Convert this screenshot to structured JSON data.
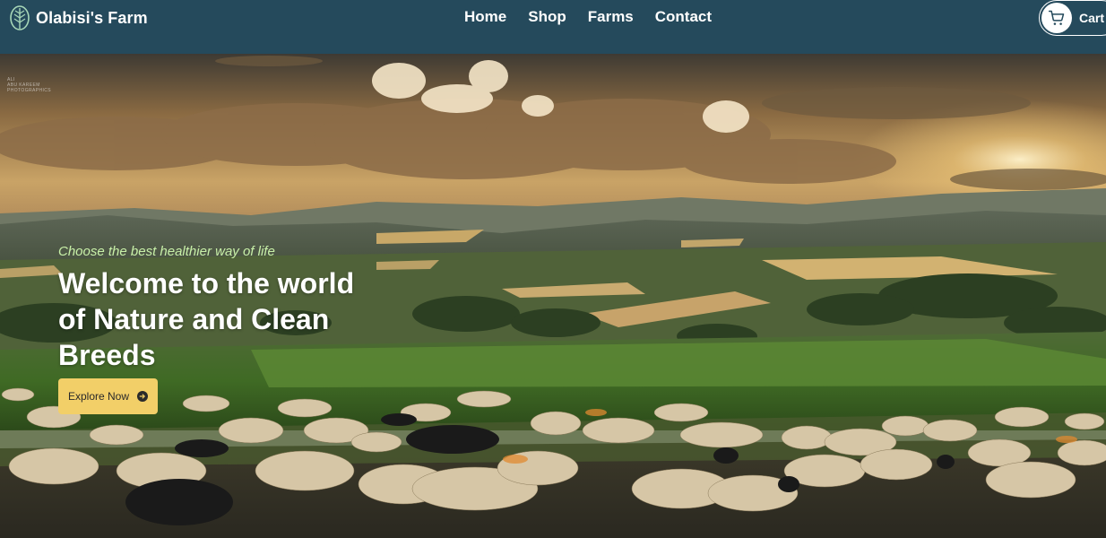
{
  "brand": {
    "name": "Olabisi's Farm",
    "logo_icon": "leaf-logo-icon"
  },
  "nav": {
    "items": [
      {
        "label": "Home"
      },
      {
        "label": "Shop"
      },
      {
        "label": "Farms"
      },
      {
        "label": "Contact"
      }
    ]
  },
  "cart": {
    "label": "Cart",
    "icon": "cart-icon"
  },
  "hero": {
    "watermark": [
      "ALI",
      "ABU KAREEM",
      "PHOTOGRAPHICS"
    ],
    "tagline": "Choose the best healthier way of life",
    "title": "Welcome to the world of Nature and Clean Breeds",
    "cta_label": "Explore Now",
    "cta_icon": "arrow-right-circle-icon"
  },
  "colors": {
    "header_bg": "#254a5c",
    "cta_bg": "#f2cf68",
    "tagline": "#c8f0a8",
    "text": "#ffffff"
  }
}
